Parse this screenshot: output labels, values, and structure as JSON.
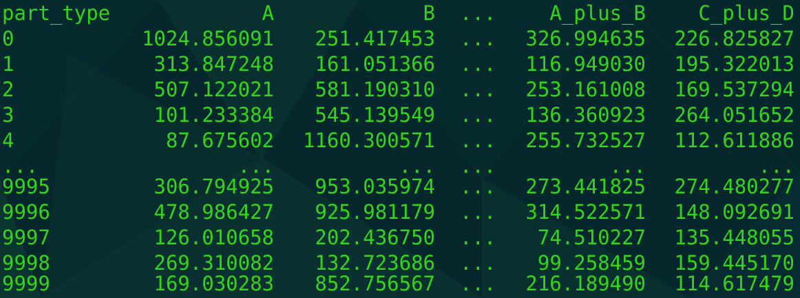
{
  "table": {
    "columns": [
      "part_type",
      "A",
      "B",
      "...",
      "A_plus_B",
      "C_plus_D"
    ],
    "rows": [
      [
        "0",
        "1024.856091",
        "251.417453",
        "...",
        "326.994635",
        "226.825827"
      ],
      [
        "1",
        "313.847248",
        "161.051366",
        "...",
        "116.949030",
        "195.322013"
      ],
      [
        "2",
        "507.122021",
        "581.190310",
        "...",
        "253.161008",
        "169.537294"
      ],
      [
        "3",
        "101.233384",
        "545.139549",
        "...",
        "136.360923",
        "264.051652"
      ],
      [
        "4",
        "87.675602",
        "1160.300571",
        "...",
        "255.732527",
        "112.611886"
      ],
      [
        "...",
        "...",
        "...",
        "...",
        "...",
        "..."
      ],
      [
        "9995",
        "306.794925",
        "953.035974",
        "...",
        "273.441825",
        "274.480277"
      ],
      [
        "9996",
        "478.986427",
        "925.981179",
        "...",
        "314.522571",
        "148.092691"
      ],
      [
        "9997",
        "126.010658",
        "202.436750",
        "...",
        "74.510227",
        "135.448055"
      ],
      [
        "9998",
        "269.310082",
        "132.723686",
        "...",
        "99.258459",
        "159.445170"
      ],
      [
        "9999",
        "169.030283",
        "852.756567",
        "...",
        "216.189490",
        "114.617479"
      ]
    ]
  },
  "colors": {
    "background": "#06272b",
    "text": "#35d41a"
  }
}
